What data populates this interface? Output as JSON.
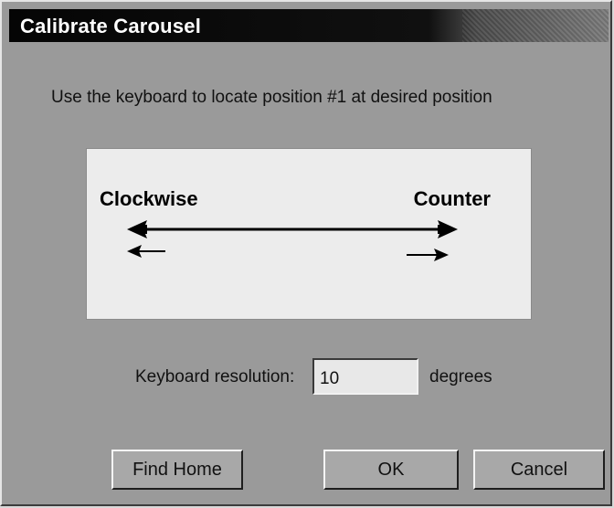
{
  "window": {
    "title": "Calibrate Carousel"
  },
  "instruction": "Use the keyboard to locate position #1 at desired position",
  "diagram": {
    "left_label": "Clockwise",
    "right_label": "Counter",
    "icons": [
      "double-arrow-icon",
      "left-arrow-icon",
      "right-arrow-icon"
    ]
  },
  "resolution": {
    "label": "Keyboard resolution:",
    "value": "10",
    "unit": "degrees"
  },
  "buttons": {
    "find_home": "Find Home",
    "ok": "OK",
    "cancel": "Cancel"
  },
  "colors": {
    "title_bar": "#050505",
    "dialog_bg": "#9a9a9a",
    "diagram_bg": "#ececec"
  }
}
